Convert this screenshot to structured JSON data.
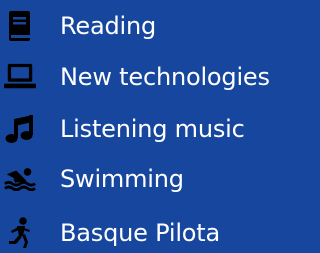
{
  "hobbies": {
    "items": [
      {
        "label": "Reading",
        "icon": "book-icon"
      },
      {
        "label": "New technologies",
        "icon": "laptop-icon"
      },
      {
        "label": "Listening music",
        "icon": "music-note-icon"
      },
      {
        "label": "Swimming",
        "icon": "swimmer-icon"
      },
      {
        "label": "Basque Pilota",
        "icon": "running-icon"
      }
    ]
  },
  "colors": {
    "background": "#17469e",
    "text": "#ffffff",
    "icon": "#000000"
  }
}
